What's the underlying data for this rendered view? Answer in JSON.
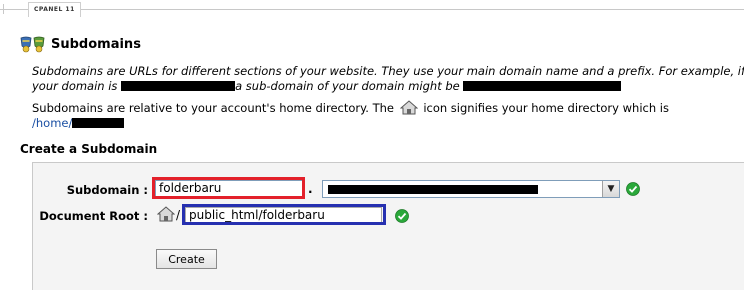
{
  "header": {
    "tab_label": "CPANEL 11"
  },
  "page": {
    "title": "Subdomains",
    "desc1_part1": "Subdomains are URLs for different sections of your website. They use your main domain name and a prefix. For example, if",
    "desc1_part2": "your domain is",
    "desc1_part3": "a sub-domain of your domain might be",
    "desc2_part1": "Subdomains are relative to your account's home directory. The",
    "desc2_part2": "icon signifies your home directory which is",
    "home_path": "/home/"
  },
  "create_section": {
    "title": "Create a Subdomain",
    "subdomain_label": "Subdomain :",
    "subdomain_value": "folderbaru",
    "dot": ".",
    "docroot_label": "Document Root :",
    "docroot_slash": "/",
    "docroot_value": "public_html/folderbaru",
    "create_button": "Create"
  },
  "icons": {
    "title_icon": "subdomains-icon",
    "home_icon": "home-icon",
    "valid_icon": "green-check-icon",
    "dropdown_icon": "chevron-down-icon"
  },
  "colors": {
    "highlight_red": "#e3202a",
    "highlight_blue": "#2630b0",
    "check_green": "#2aa83a",
    "link_blue": "#1a4fa3"
  }
}
